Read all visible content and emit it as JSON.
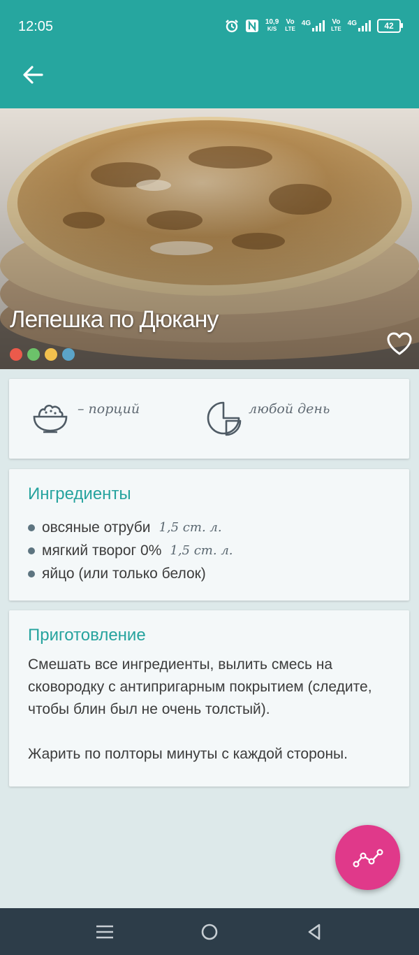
{
  "status_bar": {
    "time": "12:05",
    "net_speed_value": "10,9",
    "net_speed_unit": "K/S",
    "sim1_vo": "Vo",
    "sim1_lte": "LTE",
    "sim1_net": "4G",
    "sim2_vo": "Vo",
    "sim2_lte": "LTE",
    "sim2_net": "4G",
    "battery": "42"
  },
  "recipe": {
    "title": "Лепешка по Дюкану",
    "color_dots": [
      "#ec5a4b",
      "#6cc26a",
      "#f2c14e",
      "#5ba4c8"
    ]
  },
  "info": {
    "portions": "– порций",
    "day": "любой день"
  },
  "ingredients": {
    "title": "Ингредиенты",
    "items": [
      {
        "name": "овсяные отруби",
        "amount": "1,5 ст. л."
      },
      {
        "name": "мягкий творог 0%",
        "amount": "1,5 ст. л."
      },
      {
        "name": "яйцо (или только белок)",
        "amount": ""
      }
    ]
  },
  "preparation": {
    "title": "Приготовление",
    "paragraphs": [
      "Смешать все ингредиенты, вылить смесь на сковородку с антипригарным покрытием (следите, чтобы блин был не очень толстый).",
      "Жарить по полторы минуты с каждой стороны."
    ]
  },
  "colors": {
    "primary": "#26a69f",
    "accent": "#e0398a",
    "nav_bar": "#2d3d49"
  }
}
